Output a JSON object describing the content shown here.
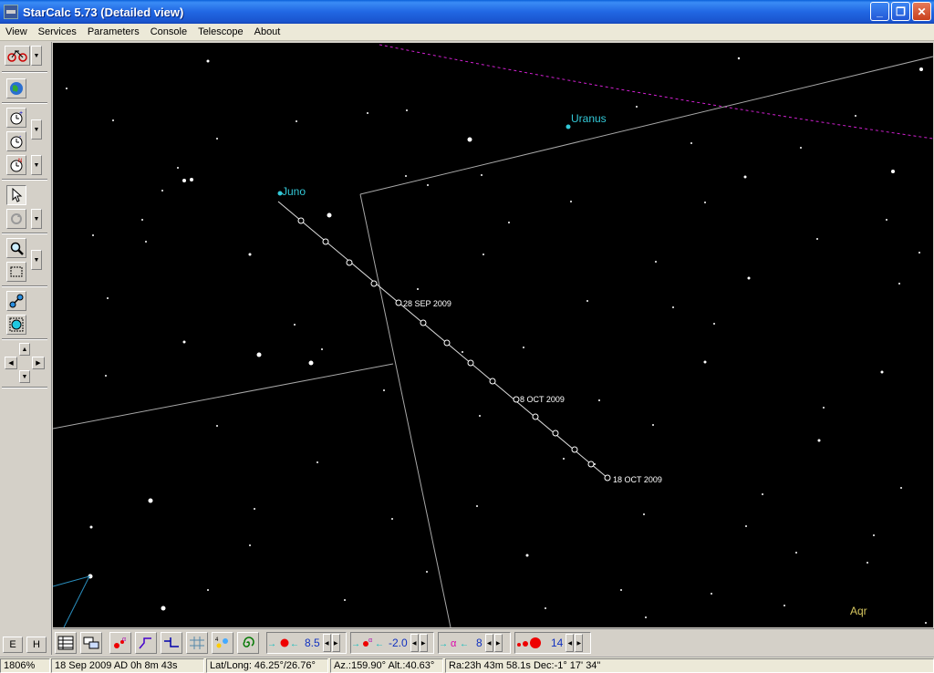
{
  "window": {
    "title": "StarCalc 5.73 (Detailed view)",
    "btn_minimize": "_",
    "btn_restore": "❐",
    "btn_close": "✕"
  },
  "menu": [
    "View",
    "Services",
    "Parameters",
    "Console",
    "Telescope",
    "About"
  ],
  "left_toolbar": {
    "e_label": "E",
    "h_label": "H"
  },
  "sky": {
    "planets": [
      {
        "name": "Uranus",
        "color": "#33c9d8"
      },
      {
        "name": "Juno",
        "color": "#33c9d8"
      }
    ],
    "track_labels": [
      "28 SEP 2009",
      "8 OCT 2009",
      "18 OCT 2009"
    ],
    "constellation": {
      "name": "Aqr",
      "color": "#d8c860"
    },
    "ecliptic_color": "#d020d0",
    "grid_color": "#a8a8a8"
  },
  "bottom_toolbar": {
    "mag_limit": "8.5",
    "alpha_value": "-2.0",
    "alpha_limit": "8",
    "size_value": "14"
  },
  "status": {
    "zoom": "1806%",
    "datetime": "18 Sep 2009 AD  0h 8m 43s",
    "latlong": "Lat/Long: 46.25°/26.76°",
    "azalt": "Az.:159.90° Alt.:40.63°",
    "radec": "Ra:23h 43m 58.1s Dec:-1° 17' 34\""
  }
}
